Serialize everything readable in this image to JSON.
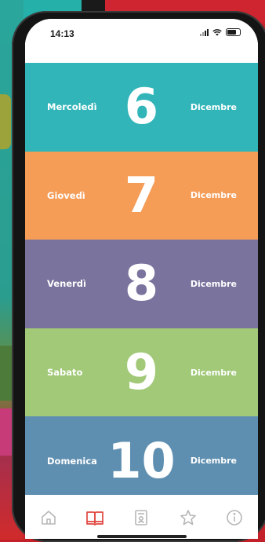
{
  "status_bar": {
    "time": "14:13"
  },
  "days": [
    {
      "weekday": "Mercoledì",
      "number": "6",
      "month": "Dicembre",
      "color": "#31b5b9"
    },
    {
      "weekday": "Giovedì",
      "number": "7",
      "month": "Dicembre",
      "color": "#f59c57"
    },
    {
      "weekday": "Venerdì",
      "number": "8",
      "month": "Dicembre",
      "color": "#79739d"
    },
    {
      "weekday": "Sabato",
      "number": "9",
      "month": "Dicembre",
      "color": "#a1c978"
    },
    {
      "weekday": "Domenica",
      "number": "10",
      "month": "Dicembre",
      "color": "#5f8fb0"
    }
  ],
  "tab_bar": {
    "items": [
      {
        "icon": "home-icon",
        "active": false
      },
      {
        "icon": "book-icon",
        "active": true
      },
      {
        "icon": "document-icon",
        "active": false
      },
      {
        "icon": "star-icon",
        "active": false
      },
      {
        "icon": "info-icon",
        "active": false
      }
    ],
    "active_color": "#e0463f",
    "inactive_color": "#b7b7b7"
  }
}
